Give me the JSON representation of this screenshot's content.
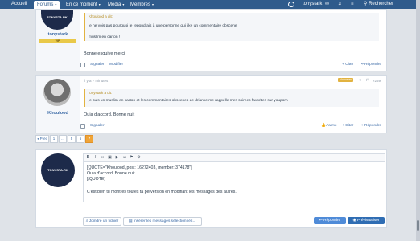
{
  "nav": {
    "items": [
      "Accueil",
      "Forums",
      "En ce moment",
      "Media",
      "Membres"
    ],
    "user": "tonystark",
    "search": "Rechercher"
  },
  "post1": {
    "logo_text": "TONYSTA.RK",
    "username": "tonystark",
    "rank": "VIP",
    "quote_header": "Khoulood a dit:",
    "quote_lines": [
      "je ne vois pas pourquoi je repondrais à une personne qui like un commentaire obscene",
      "muslim en carton !"
    ],
    "body": "Bonne esquive merci",
    "actions": {
      "report": "Signaler",
      "edit": "Modifier",
      "quote": "+ Citer",
      "reply": "Répondre"
    }
  },
  "post2": {
    "username": "Khoulood",
    "time": "Il y a 7 minutes",
    "badge": "Nouveau",
    "post_no": "#269",
    "quote_header": "tonystark a dit:",
    "quote_line": "je suis un muslim en carton et les commentaires obscenes de drianke me rappelle mes soirees favorites sur youporn",
    "body": "Ouia d'accord. Bonne nuit",
    "actions": {
      "report": "Signaler",
      "like": "J'aime",
      "quote": "+ Citer",
      "reply": "Répondre"
    }
  },
  "pager": {
    "prev": "◂ Préc",
    "pages": [
      "1",
      "…",
      "5",
      "6",
      "7"
    ],
    "current": "7"
  },
  "editor": {
    "logo_text": "TONYSTA.RK",
    "lines": [
      "[QUOTE=\"Khoulood, post: 16272403, member: 374178\"]",
      "Ouia d'accord. Bonne nuit",
      "[/QUOTE]",
      "",
      "C'est bien tu montres toutes ta perversion en modifiant les messages des autres."
    ],
    "attach": "Joindre un fichier",
    "insert": "Insérer les messages sélectionnés…",
    "reply_btn": "Répondre",
    "preview_btn": "Prévisualiser"
  },
  "colors": {
    "nav": "#2f5b8c",
    "accent": "#e2b341",
    "link": "#3b6aa6"
  }
}
